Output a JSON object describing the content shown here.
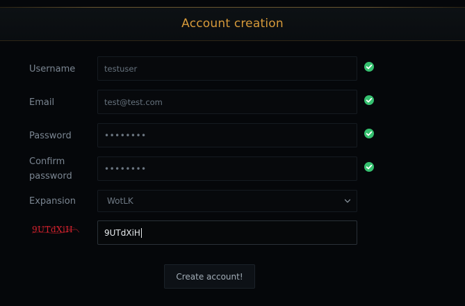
{
  "header": {
    "title": "Account creation"
  },
  "form": {
    "username": {
      "label": "Username",
      "value": "testuser"
    },
    "email": {
      "label": "Email",
      "value": "test@test.com"
    },
    "password": {
      "label": "Password",
      "value": "••••••••"
    },
    "confirm": {
      "label_line1": "Confirm",
      "label_line2": "password",
      "value": "••••••••"
    },
    "expansion": {
      "label": "Expansion",
      "selected": "WotLK"
    },
    "captcha": {
      "image_text": "9UTdXiH",
      "value": "9UTdXiH"
    },
    "submit_label": "Create account!"
  },
  "icons": {
    "valid": "check-circle-icon",
    "dropdown": "chevron-down-icon"
  },
  "colors": {
    "accent": "#d79a3a",
    "valid": "#35c06f",
    "captcha": "#d6222e"
  }
}
